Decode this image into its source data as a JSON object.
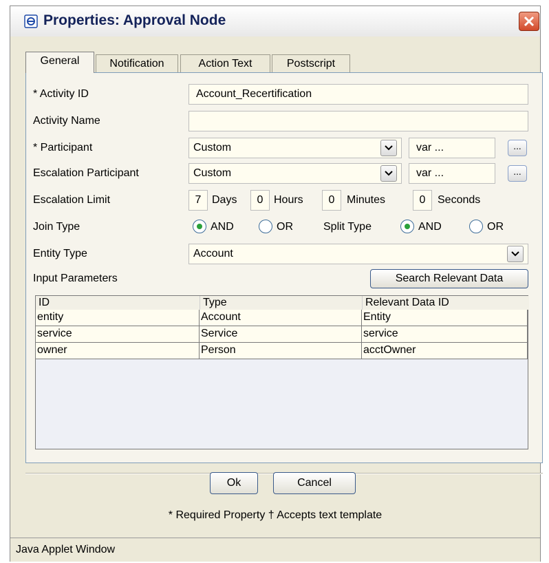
{
  "window": {
    "title": "Properties: Approval Node",
    "status_text": "Java Applet Window"
  },
  "tabs": [
    {
      "label": "General",
      "active": true
    },
    {
      "label": "Notification",
      "active": false
    },
    {
      "label": "Action Text",
      "active": false
    },
    {
      "label": "Postscript",
      "active": false
    }
  ],
  "form": {
    "activity_id": {
      "label": "* Activity ID",
      "value": "Account_Recertification"
    },
    "activity_name": {
      "label": "Activity Name",
      "value": ""
    },
    "participant": {
      "label": "* Participant",
      "selected": "Custom",
      "var_value": "var ...",
      "browse_label": "..."
    },
    "escalation_participant": {
      "label": "Escalation Participant",
      "selected": "Custom",
      "var_value": "var ...",
      "browse_label": "..."
    },
    "escalation_limit": {
      "label": "Escalation Limit",
      "days": "7",
      "days_label": "Days",
      "hours": "0",
      "hours_label": "Hours",
      "minutes": "0",
      "minutes_label": "Minutes",
      "seconds": "0",
      "seconds_label": "Seconds"
    },
    "join_type": {
      "label": "Join Type",
      "options": [
        "AND",
        "OR"
      ],
      "selected": "AND"
    },
    "split_type": {
      "label": "Split Type",
      "options": [
        "AND",
        "OR"
      ],
      "selected": "AND"
    },
    "entity_type": {
      "label": "Entity Type",
      "selected": "Account"
    },
    "input_parameters": {
      "label": "Input Parameters",
      "search_button": "Search Relevant Data",
      "columns": [
        "ID",
        "Type",
        "Relevant Data ID"
      ],
      "rows": [
        [
          "entity",
          "Account",
          "Entity"
        ],
        [
          "service",
          "Service",
          "service"
        ],
        [
          "owner",
          "Person",
          "acctOwner"
        ]
      ]
    }
  },
  "buttons": {
    "ok": "Ok",
    "cancel": "Cancel"
  },
  "footer_note": "* Required Property † Accepts text template",
  "colors": {
    "accent": "#2aa03a",
    "close_button": "#d24a2b",
    "field_background": "#fffdf0"
  },
  "icons": {
    "app": "applet-icon",
    "close": "close-icon",
    "dropdown": "chevron-down-icon"
  }
}
